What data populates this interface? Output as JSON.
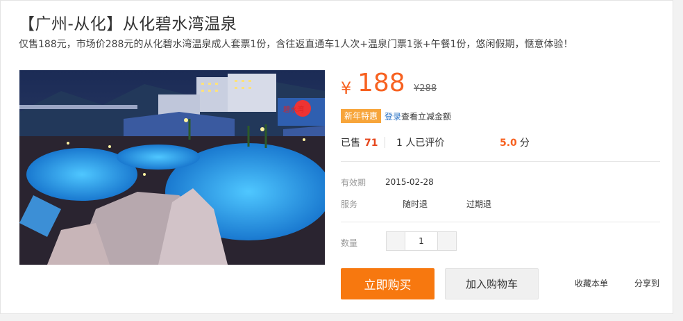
{
  "product": {
    "title": "【广州-从化】从化碧水湾温泉",
    "subtitle": "仅售188元，市场价288元的从化碧水湾温泉成人套票1份，含往返直通车1人次+温泉门票1张+午餐1份，悠闲假期，惬意体验！",
    "photo": {
      "sign_text": "碧水湾"
    }
  },
  "price": {
    "currency_symbol": "¥",
    "current": "188",
    "original": "¥288"
  },
  "promo": {
    "badge": "新年特惠",
    "login_text": "登录",
    "discount_text": "查看立减金额"
  },
  "stats": {
    "sold_label": "已售",
    "sold_count": "71",
    "review_count": "1",
    "review_label": "人已评价",
    "score": "5.0",
    "score_unit": "分"
  },
  "details": {
    "validity_label": "有效期",
    "validity_value": "2015-02-28",
    "service_label": "服务",
    "service_refund_anytime": "随时退",
    "service_refund_expired": "过期退",
    "quantity_label": "数量",
    "quantity_value": "1"
  },
  "actions": {
    "buy_label": "立即购买",
    "cart_label": "加入购物车",
    "favorite_label": "收藏本单",
    "share_label": "分享到"
  },
  "colors": {
    "accent": "#f76120",
    "buy_button": "#f7780f",
    "badge": "#f7a53a",
    "link": "#2d74c5"
  }
}
